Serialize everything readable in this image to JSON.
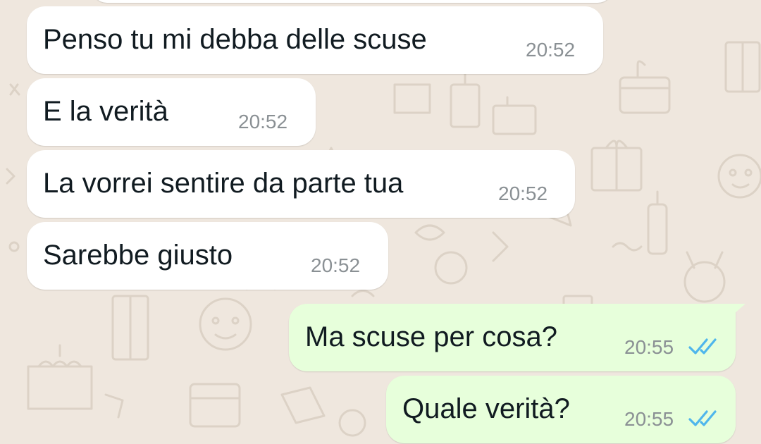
{
  "theme": {
    "background": "#efe7de",
    "incoming_bubble": "#ffffff",
    "outgoing_bubble": "#e7ffdb",
    "text": "#111b21",
    "timestamp": "#8a9094",
    "read_ticks": "#4fb6ec"
  },
  "messages": [
    {
      "direction": "incoming",
      "text": "Penso tu mi debba delle scuse",
      "time": "20:52"
    },
    {
      "direction": "incoming",
      "text": "E la verità",
      "time": "20:52"
    },
    {
      "direction": "incoming",
      "text": "La vorrei sentire da parte tua",
      "time": "20:52"
    },
    {
      "direction": "incoming",
      "text": "Sarebbe giusto",
      "time": "20:52"
    },
    {
      "direction": "outgoing",
      "text": "Ma scuse per cosa?",
      "time": "20:55",
      "status": "read",
      "status_icon": "double-check-icon"
    },
    {
      "direction": "outgoing",
      "text": "Quale verità?",
      "time": "20:55",
      "status": "read",
      "status_icon": "double-check-icon"
    }
  ]
}
